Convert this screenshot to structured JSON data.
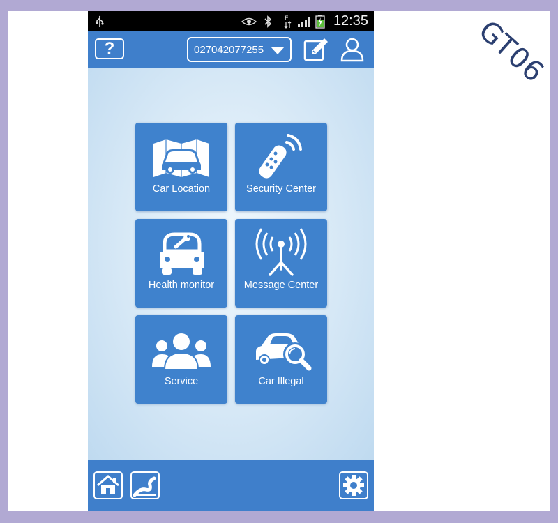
{
  "watermark": "GT06",
  "status_bar": {
    "time": "12:35",
    "icons": [
      "usb-icon",
      "eye-icon",
      "bluetooth-icon",
      "data-arrows-icon",
      "signal-icon",
      "battery-icon"
    ]
  },
  "header": {
    "help_label": "?",
    "device_number": "027042077255",
    "icons": [
      "edit-icon",
      "user-icon"
    ]
  },
  "tiles": [
    {
      "label": "Car Location",
      "icon": "car-map-icon"
    },
    {
      "label": "Security Center",
      "icon": "remote-control-icon"
    },
    {
      "label": "Health monitor",
      "icon": "car-wrench-icon"
    },
    {
      "label": "Message Center",
      "icon": "antenna-icon"
    },
    {
      "label": "Service",
      "icon": "people-icon"
    },
    {
      "label": "Car Illegal",
      "icon": "car-search-icon"
    }
  ],
  "footer": {
    "icons": [
      "home-icon",
      "route-icon",
      "settings-icon"
    ]
  },
  "colors": {
    "accent": "#3f7fcb",
    "tile": "#3f82cd",
    "frame": "#b1a9d3",
    "watermark": "#2b3f70"
  }
}
